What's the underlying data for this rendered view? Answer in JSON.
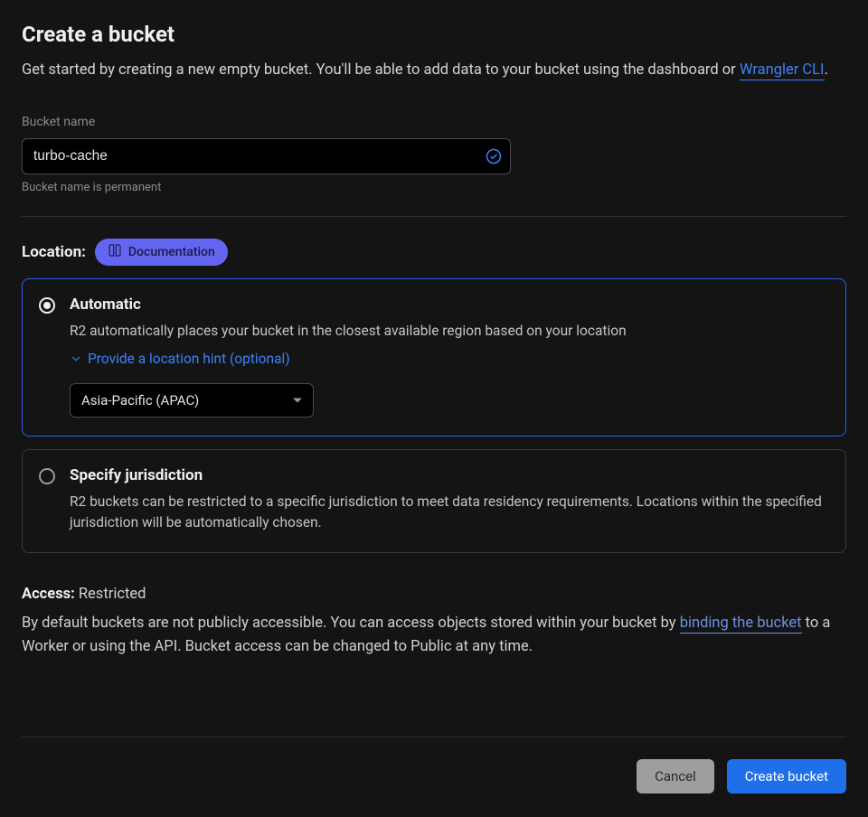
{
  "page": {
    "title": "Create a bucket",
    "intro_prefix": "Get started by creating a new empty bucket. You'll be able to add data to your bucket using the dashboard or ",
    "intro_link_label": "Wrangler CLI",
    "intro_suffix": "."
  },
  "bucket_name": {
    "label": "Bucket name",
    "value": "turbo-cache",
    "hint": "Bucket name is permanent",
    "valid": true
  },
  "location": {
    "section_label": "Location:",
    "doc_pill_label": "Documentation",
    "options": {
      "automatic": {
        "title": "Automatic",
        "description": "R2 automatically places your bucket in the closest available region based on your location",
        "hint_toggle_label": "Provide a location hint (optional)",
        "selected_hint": "Asia-Pacific (APAC)",
        "checked": true
      },
      "jurisdiction": {
        "title": "Specify jurisdiction",
        "description": "R2 buckets can be restricted to a specific jurisdiction to meet data residency requirements. Locations within the specified jurisdiction will be automatically chosen.",
        "checked": false
      }
    }
  },
  "access": {
    "heading_label": "Access:",
    "heading_value": "Restricted",
    "text_prefix": "By default buckets are not publicly accessible. You can access objects stored within your bucket by ",
    "link_label": "binding the bucket",
    "text_suffix": " to a Worker or using the API. Bucket access can be changed to Public at any time."
  },
  "footer": {
    "cancel_label": "Cancel",
    "create_label": "Create bucket"
  }
}
